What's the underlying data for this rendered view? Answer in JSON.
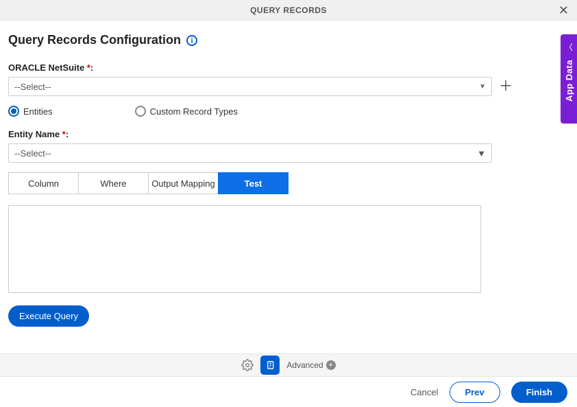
{
  "header": {
    "title": "QUERY RECORDS"
  },
  "page": {
    "title": "Query Records Configuration"
  },
  "fields": {
    "connection": {
      "label": "ORACLE NetSuite ",
      "required": "*",
      "placeholder": "--Select--"
    },
    "entity_name": {
      "label": "Entity Name ",
      "required": "*",
      "placeholder": "--Select--"
    }
  },
  "radios": {
    "entities": "Entities",
    "custom": "Custom Record Types"
  },
  "tabs": {
    "column": "Column",
    "where": "Where",
    "output": "Output Mapping",
    "test": "Test"
  },
  "buttons": {
    "execute": "Execute Query",
    "cancel": "Cancel",
    "prev": "Prev",
    "finish": "Finish",
    "advanced": "Advanced"
  },
  "side": {
    "label": "App Data"
  }
}
